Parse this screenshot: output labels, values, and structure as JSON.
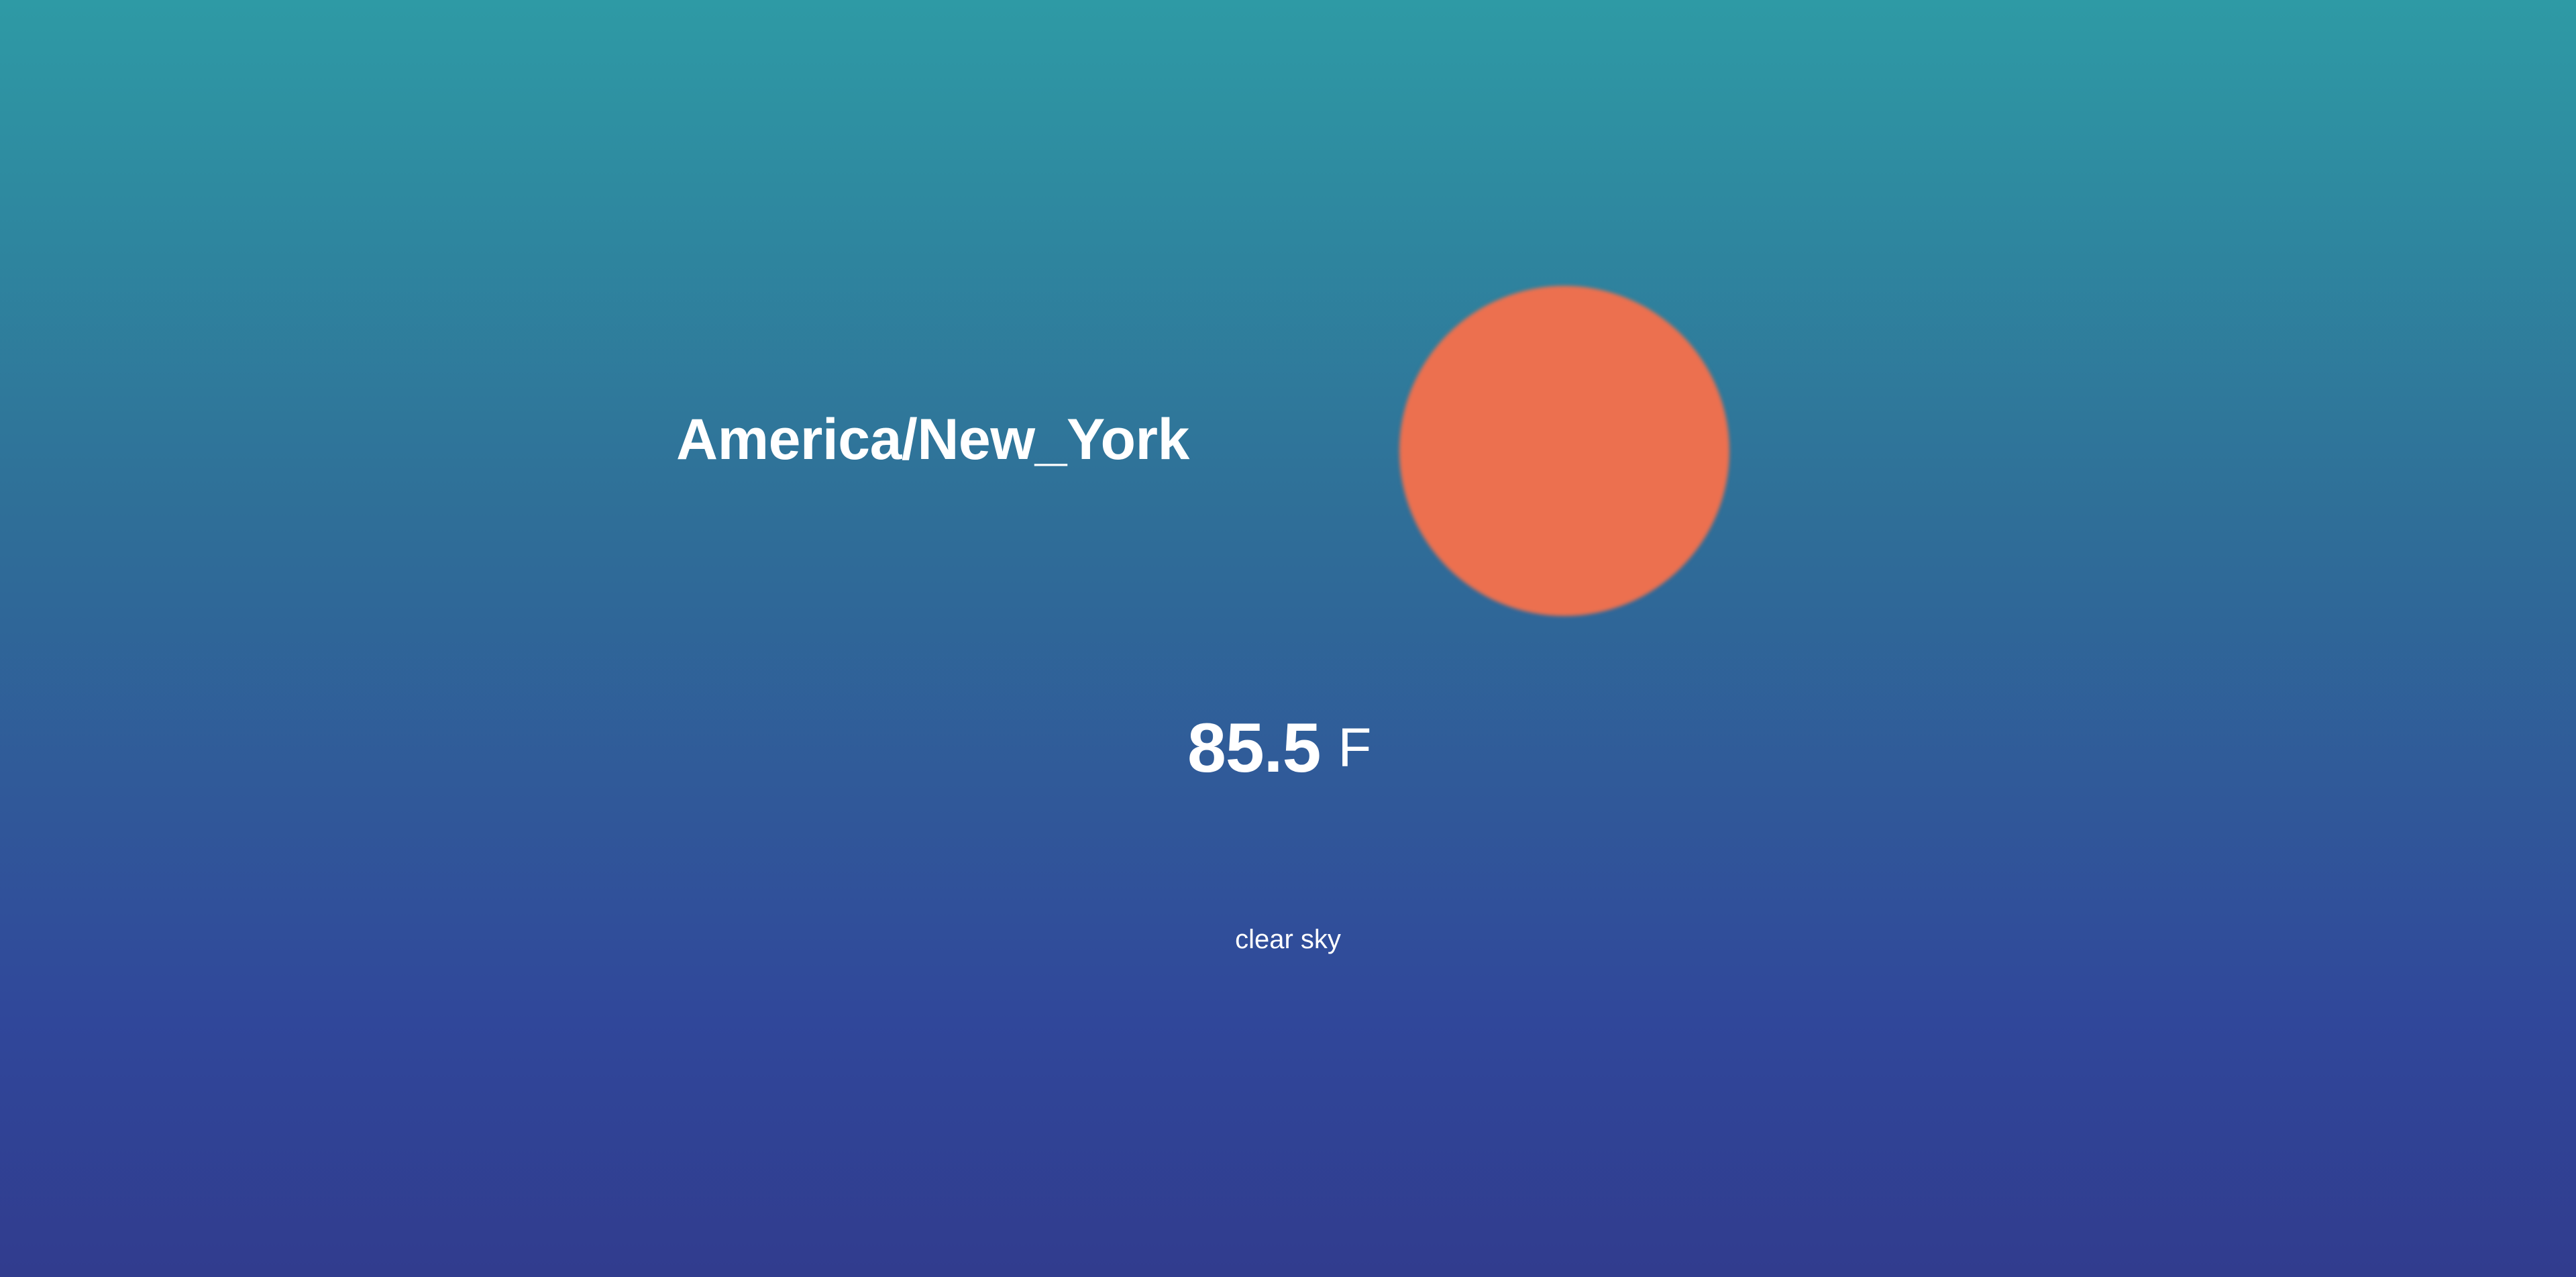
{
  "location": {
    "timezone": "America/New_York"
  },
  "weather": {
    "icon": "sun-icon",
    "icon_color": "#ec704f",
    "temperature": "85.5",
    "unit": "F",
    "description": "clear sky"
  },
  "theme": {
    "gradient_top": "#2e9aa5",
    "gradient_bottom": "#313c8e",
    "text_color": "#ffffff"
  }
}
